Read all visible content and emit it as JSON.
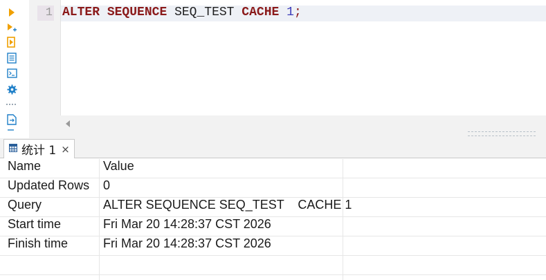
{
  "toolbar": {
    "icons": [
      "run-icon",
      "run-current-icon",
      "explain-icon",
      "list-icon",
      "console-icon",
      "settings-icon",
      "export-icon"
    ]
  },
  "editor": {
    "line_number": "1",
    "code": {
      "kw_alter": "ALTER",
      "kw_sequence": "SEQUENCE",
      "ident": "SEQ_TEST",
      "kw_cache": "CACHE",
      "number": "1",
      "semicolon": ";"
    }
  },
  "results": {
    "tab_label": "统计 1",
    "tab_close": "×",
    "headers": [
      "Name",
      "Value"
    ],
    "rows": [
      [
        "Updated Rows",
        "0"
      ],
      [
        "Query",
        "ALTER SEQUENCE SEQ_TEST    CACHE 1"
      ],
      [
        "Start time",
        "Fri Mar 20 14:28:37 CST 2026"
      ],
      [
        "Finish time",
        "Fri Mar 20 14:28:37 CST 2026"
      ]
    ]
  },
  "colors": {
    "keyword": "#8b1a1a",
    "number": "#3a3ab8",
    "icon_orange": "#f0a000",
    "icon_blue": "#1e7fc8"
  }
}
